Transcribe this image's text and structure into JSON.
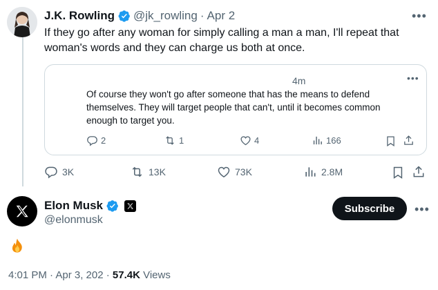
{
  "tweet1": {
    "author_name": "J.K. Rowling",
    "handle": "@jk_rowling",
    "separator": "·",
    "date": "Apr 2",
    "text": "If they go after any woman for simply calling a man a man, I'll repeat that woman's words and they can charge us both at once.",
    "more": "•••",
    "actions": {
      "replies": "3K",
      "retweets": "13K",
      "likes": "73K",
      "views": "2.8M"
    }
  },
  "quote": {
    "time": "4m",
    "more": "•••",
    "text": "Of course they won't go after someone that has the means to defend themselves. They will target people that can't, until it becomes common enough to target you.",
    "actions": {
      "replies": "2",
      "retweets": "1",
      "likes": "4",
      "views": "166"
    }
  },
  "tweet2": {
    "author_name": "Elon Musk",
    "handle": "@elonmusk",
    "subscribe_label": "Subscribe",
    "more": "•••",
    "text": "🔥",
    "meta_time": "4:01 PM · Apr 3, 202",
    "meta_sep": " · ",
    "meta_views_count": "57.4K",
    "meta_views_label": " Views"
  },
  "colors": {
    "verified": "#1d9bf0",
    "secondary_text": "#536471",
    "border": "#cfd9de",
    "subscribe_bg": "#0f1419"
  },
  "icons": [
    "verified-badge-icon",
    "more-icon",
    "reply-icon",
    "retweet-icon",
    "like-icon",
    "views-icon",
    "bookmark-icon",
    "share-icon",
    "x-logo-icon",
    "fire-icon"
  ]
}
